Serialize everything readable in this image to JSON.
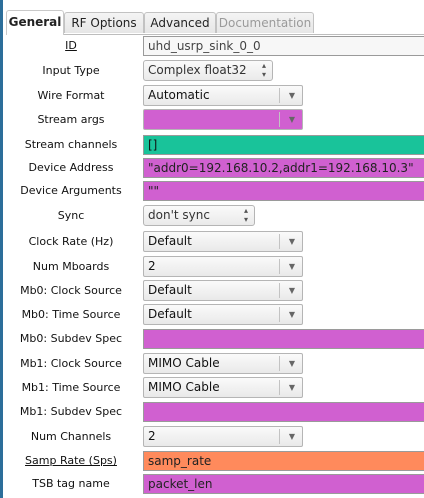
{
  "tabs": [
    {
      "label": "General",
      "state": "active"
    },
    {
      "label": "RF Options",
      "state": "normal"
    },
    {
      "label": "Advanced",
      "state": "normal"
    },
    {
      "label": "Documentation",
      "state": "disabled"
    }
  ],
  "colors": {
    "magenta": "#d060d0",
    "teal": "#19c39a",
    "orange": "#ff8a5c",
    "accent": "#2c6e9a"
  },
  "params": {
    "id": {
      "label": "ID",
      "value": "uhd_usrp_sink_0_0"
    },
    "input_type": {
      "label": "Input Type",
      "value": "Complex float32"
    },
    "wire_format": {
      "label": "Wire Format",
      "value": "Automatic"
    },
    "stream_args": {
      "label": "Stream args",
      "value": ""
    },
    "stream_channels": {
      "label": "Stream channels",
      "value": "[]"
    },
    "device_address": {
      "label": "Device Address",
      "value": "\"addr0=192.168.10.2,addr1=192.168.10.3\""
    },
    "device_arguments": {
      "label": "Device Arguments",
      "value": "\"\""
    },
    "sync": {
      "label": "Sync",
      "value": "don't sync"
    },
    "clock_rate": {
      "label": "Clock Rate (Hz)",
      "value": "Default"
    },
    "num_mboards": {
      "label": "Num Mboards",
      "value": "2"
    },
    "mb0_clock_source": {
      "label": "Mb0: Clock Source",
      "value": "Default"
    },
    "mb0_time_source": {
      "label": "Mb0: Time Source",
      "value": "Default"
    },
    "mb0_subdev_spec": {
      "label": "Mb0: Subdev Spec",
      "value": ""
    },
    "mb1_clock_source": {
      "label": "Mb1: Clock Source",
      "value": "MIMO Cable"
    },
    "mb1_time_source": {
      "label": "Mb1: Time Source",
      "value": "MIMO Cable"
    },
    "mb1_subdev_spec": {
      "label": "Mb1: Subdev Spec",
      "value": ""
    },
    "num_channels": {
      "label": "Num Channels",
      "value": "2"
    },
    "samp_rate": {
      "label": "Samp Rate (Sps)",
      "value": "samp_rate"
    },
    "tsb_tag_name": {
      "label": "TSB tag name",
      "value": "packet_len"
    }
  }
}
